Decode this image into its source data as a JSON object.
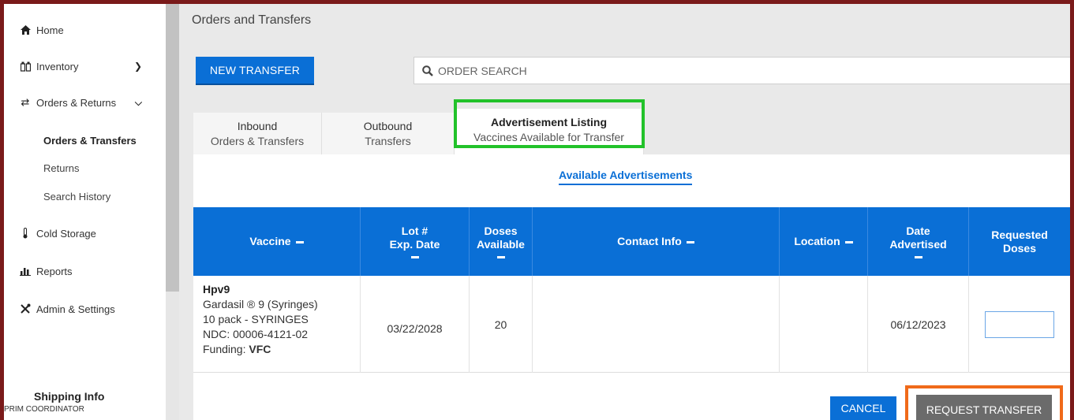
{
  "sidebar": {
    "items": [
      {
        "label": "Home",
        "icon": "home-icon"
      },
      {
        "label": "Inventory",
        "icon": "inventory-icon"
      },
      {
        "label": "Orders & Returns",
        "icon": "transfer-arrows-icon"
      },
      {
        "label": "Cold Storage",
        "icon": "thermometer-icon"
      },
      {
        "label": "Reports",
        "icon": "bar-chart-icon"
      },
      {
        "label": "Admin & Settings",
        "icon": "tools-icon"
      }
    ],
    "sub_items": [
      {
        "label": "Orders & Transfers",
        "active": true
      },
      {
        "label": "Returns"
      },
      {
        "label": "Search History"
      }
    ],
    "shipping_title": "Shipping Info",
    "shipping_role": "PRIM COORDINATOR"
  },
  "main": {
    "page_title": "Orders and Transfers",
    "new_transfer_label": "NEW TRANSFER",
    "search_placeholder": "ORDER SEARCH",
    "tabs": [
      {
        "line1": "Inbound",
        "line2": "Orders & Transfers"
      },
      {
        "line1": "Outbound",
        "line2": "Transfers"
      },
      {
        "line1": "Advertisement Listing",
        "line2": "Vaccines Available for Transfer",
        "active": true
      }
    ],
    "available_link": "Available Advertisements",
    "table": {
      "headers": {
        "vaccine": "Vaccine",
        "lot_1": "Lot #",
        "lot_2": "Exp. Date",
        "doses_1": "Doses",
        "doses_2": "Available",
        "contact": "Contact Info",
        "location": "Location",
        "date_1": "Date",
        "date_2": "Advertised",
        "req_1": "Requested",
        "req_2": "Doses"
      },
      "row": {
        "vaccine_name": "Hpv9",
        "vaccine_product": "Gardasil ® 9 (Syringes)",
        "vaccine_pack": "10 pack - SYRINGES",
        "vaccine_ndc": "NDC: 00006-4121-02",
        "funding_label": "Funding: ",
        "funding_value": "VFC",
        "exp_date": "03/22/2028",
        "doses_available": "20",
        "contact_info": "",
        "location": "",
        "date_advertised": "06/12/2023",
        "requested_doses": ""
      }
    },
    "cancel_label": "CANCEL",
    "request_label": "REQUEST TRANSFER"
  },
  "colors": {
    "primary": "#0a6fd6",
    "frame": "#7a1a1a",
    "tab_highlight": "#22c22a",
    "request_highlight": "#f06a1a",
    "request_button": "#6b6b6b"
  }
}
